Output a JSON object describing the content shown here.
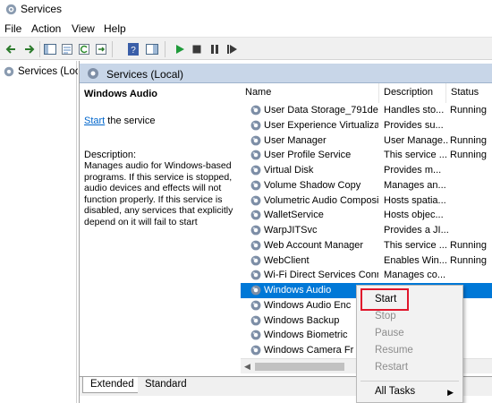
{
  "window": {
    "title": "Services"
  },
  "menu": [
    "File",
    "Action",
    "View",
    "Help"
  ],
  "toolbar": {
    "icons": [
      "back-icon",
      "forward-icon",
      "show-hide-tree-icon",
      "properties-icon",
      "refresh-icon",
      "export-list-icon",
      "help-icon",
      "show-action-pane-icon",
      "start-service-icon",
      "stop-service-icon",
      "pause-service-icon",
      "restart-service-icon"
    ]
  },
  "tree": {
    "root_label": "Services (Local)"
  },
  "panel": {
    "header_title": "Services (Local)",
    "selected_service": "Windows Audio",
    "start_link": "Start",
    "start_suffix": " the service",
    "description_label": "Description:",
    "description_text": "Manages audio for Windows-based programs.  If this service is stopped, audio devices and effects will not function properly.  If this service is disabled, any services that explicitly depend on it will fail to start"
  },
  "columns": [
    "Name",
    "Description",
    "Status"
  ],
  "services": [
    {
      "name": "User Data Storage_791de",
      "description": "Handles sto...",
      "status": "Running"
    },
    {
      "name": "User Experience Virtualizatio...",
      "description": "Provides su...",
      "status": ""
    },
    {
      "name": "User Manager",
      "description": "User Manage...",
      "status": "Running"
    },
    {
      "name": "User Profile Service",
      "description": "This service ...",
      "status": "Running"
    },
    {
      "name": "Virtual Disk",
      "description": "Provides m...",
      "status": ""
    },
    {
      "name": "Volume Shadow Copy",
      "description": "Manages an...",
      "status": ""
    },
    {
      "name": "Volumetric Audio Composit...",
      "description": "Hosts spatia...",
      "status": ""
    },
    {
      "name": "WalletService",
      "description": "Hosts objec...",
      "status": ""
    },
    {
      "name": "WarpJITSvc",
      "description": "Provides a JI...",
      "status": ""
    },
    {
      "name": "Web Account Manager",
      "description": "This service ...",
      "status": "Running"
    },
    {
      "name": "WebClient",
      "description": "Enables Win...",
      "status": "Running"
    },
    {
      "name": "Wi-Fi Direct Services Conne...",
      "description": "Manages co...",
      "status": ""
    },
    {
      "name": "Windows Audio",
      "description": "",
      "status": ""
    },
    {
      "name": "Windows Audio Enc",
      "description": "",
      "status": ""
    },
    {
      "name": "Windows Backup",
      "description": "",
      "status": ""
    },
    {
      "name": "Windows Biometric",
      "description": "",
      "status": ""
    },
    {
      "name": "Windows Camera Fr",
      "description": "",
      "status": ""
    }
  ],
  "tabs": [
    "Extended",
    "Standard"
  ],
  "context_menu": {
    "items": [
      "Start",
      "Stop",
      "Pause",
      "Resume",
      "Restart"
    ],
    "all_tasks": "All Tasks",
    "disabled": [
      "Stop",
      "Pause",
      "Resume",
      "Restart"
    ],
    "highlight_color": "#e0162b"
  },
  "colors": {
    "selection": "#0078d7",
    "panel_header": "#c8d6e8",
    "link": "#0066cc"
  }
}
